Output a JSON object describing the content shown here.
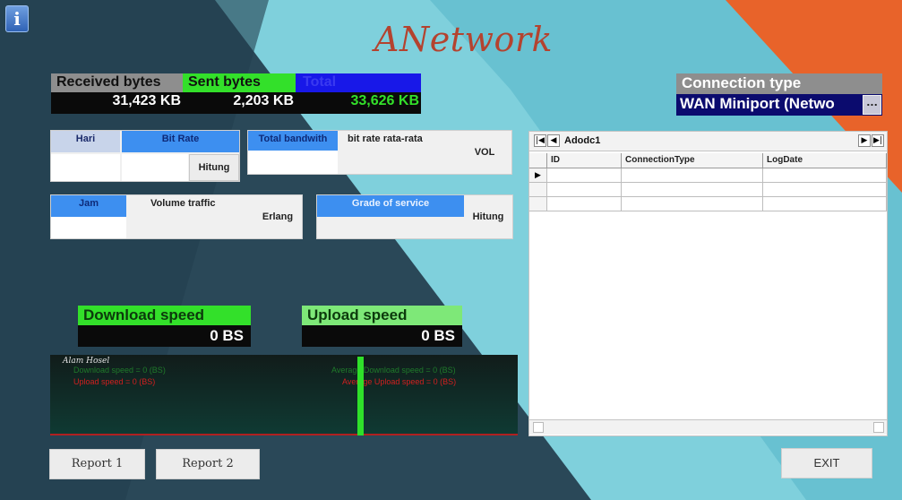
{
  "app": {
    "logo": "ANetwork",
    "info_icon": "i"
  },
  "traffic": {
    "received_label": "Received bytes",
    "sent_label": "Sent bytes",
    "total_label": "Total",
    "received_value": "31,423 KB",
    "sent_value": "2,203 KB",
    "total_value": "33,626 KB"
  },
  "connection": {
    "label": "Connection type",
    "value": "WAN Miniport (Netwo",
    "button": "..."
  },
  "bitrate_panel": {
    "hari_label": "Hari",
    "bitrate_label": "Bit Rate",
    "hitung_label": "Hitung"
  },
  "bandwidth_panel": {
    "total_bandwidth_label": "Total bandwith",
    "avg_label": "bit rate rata-rata",
    "vol_label": "VOL"
  },
  "erlang_panel": {
    "jam_label": "Jam",
    "volume_label": "Volume traffic",
    "erlang_label": "Erlang"
  },
  "gos_panel": {
    "gos_label": "Grade of service",
    "hitung_label": "Hitung"
  },
  "speed": {
    "download_label": "Download speed",
    "download_value": "0 BS",
    "upload_label": "Upload speed",
    "upload_value": "0 BS"
  },
  "graph": {
    "title": "Alam Hosel",
    "left_green": "Download speed = 0 (BS)",
    "left_red": "Upload speed = 0 (BS)",
    "right_green": "Average Download speed = 0 (BS)",
    "right_red": "Average Upload speed = 0 (BS)"
  },
  "grid": {
    "caption": "Adodc1",
    "columns": [
      "ID",
      "ConnectionType",
      "LogDate"
    ],
    "nav_first": "|◀",
    "nav_prev": "◀",
    "nav_next": "▶",
    "nav_last": "▶|",
    "row_marker": "▶"
  },
  "buttons": {
    "report1": "Report 1",
    "report2": "Report 2",
    "exit": "EXIT"
  },
  "colors": {
    "sent": "#33e02a",
    "total": "#1818e8",
    "logo": "#b4432f",
    "orange": "#e8632a"
  }
}
